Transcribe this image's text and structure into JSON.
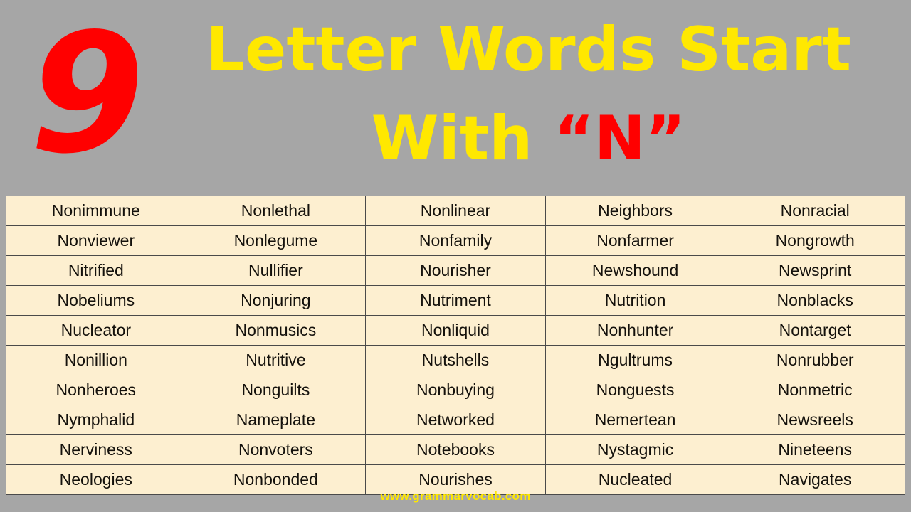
{
  "header": {
    "number": "9",
    "title_line1": "Letter Words Start",
    "title_line2_prefix": "With ",
    "title_line2_quoted": "“N”",
    "colors": {
      "number": "#ff0000",
      "title": "#ffe800",
      "quoted": "#ff0000",
      "background": "#a6a6a6"
    }
  },
  "table": {
    "columns": 5,
    "rows": [
      [
        "Nonimmune",
        "Nonlethal",
        "Nonlinear",
        "Neighbors",
        "Nonracial"
      ],
      [
        "Nonviewer",
        "Nonlegume",
        "Nonfamily",
        "Nonfarmer",
        "Nongrowth"
      ],
      [
        "Nitrified",
        "Nullifier",
        "Nourisher",
        "Newshound",
        "Newsprint"
      ],
      [
        "Nobeliums",
        "Nonjuring",
        "Nutriment",
        "Nutrition",
        "Nonblacks"
      ],
      [
        "Nucleator",
        "Nonmusics",
        "Nonliquid",
        "Nonhunter",
        "Nontarget"
      ],
      [
        "Nonillion",
        "Nutritive",
        "Nutshells",
        "Ngultrums",
        "Nonrubber"
      ],
      [
        "Nonheroes",
        "Nonguilts",
        "Nonbuying",
        "Nonguests",
        "Nonmetric"
      ],
      [
        "Nymphalid",
        "Nameplate",
        "Networked",
        "Nemertean",
        "Newsreels"
      ],
      [
        "Nerviness",
        "Nonvoters",
        "Notebooks",
        "Nystagmic",
        "Nineteens"
      ],
      [
        "Neologies",
        "Nonbonded",
        "Nourishes",
        "Nucleated",
        "Navigates"
      ]
    ]
  },
  "footer": {
    "website": "www.grammarvocab.com"
  }
}
